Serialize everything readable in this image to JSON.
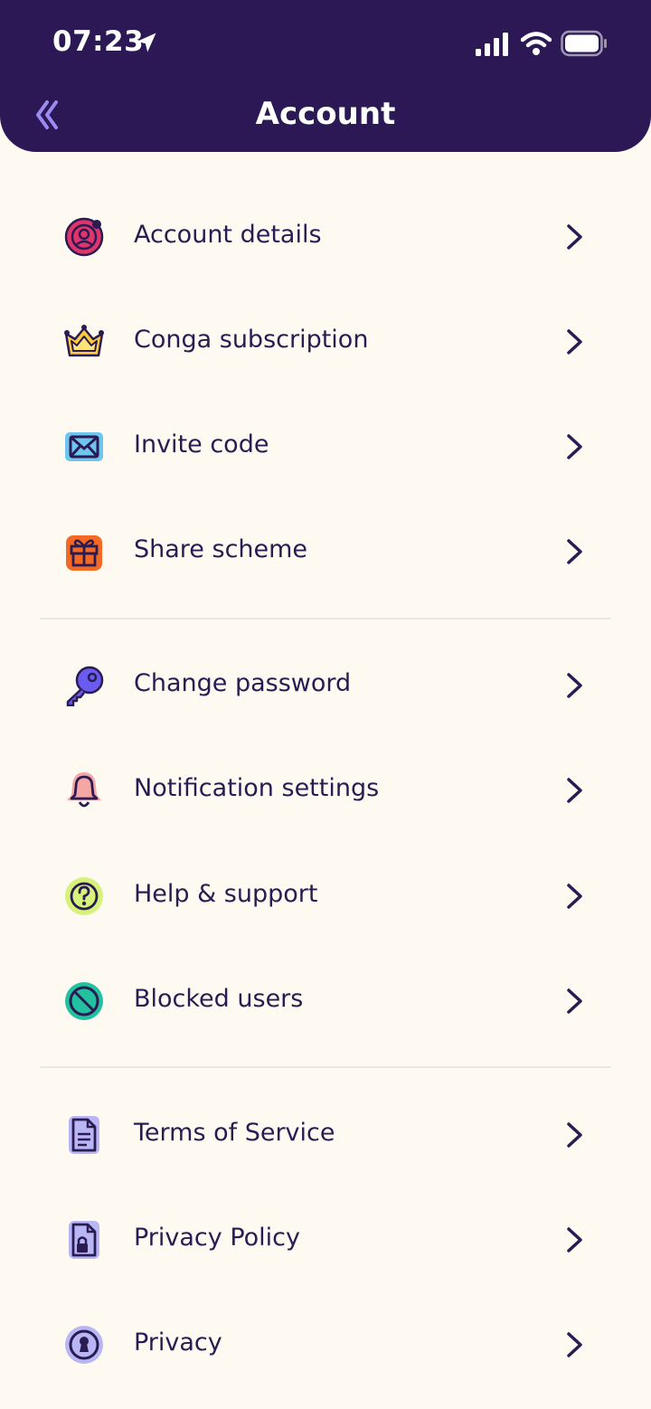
{
  "status_bar": {
    "time": "07:23"
  },
  "header": {
    "title": "Account"
  },
  "menu": {
    "group1": [
      {
        "label": "Account details",
        "icon": "account-circle-icon",
        "color": "#E0356B"
      },
      {
        "label": "Conga subscription",
        "icon": "crown-icon",
        "color": "#FFCB3D"
      },
      {
        "label": "Invite code",
        "icon": "envelope-icon",
        "color": "#6EC6F0"
      },
      {
        "label": "Share scheme",
        "icon": "gift-icon",
        "color": "#F46A24"
      }
    ],
    "group2": [
      {
        "label": "Change password",
        "icon": "key-icon",
        "color": "#6A5CF0"
      },
      {
        "label": "Notification settings",
        "icon": "bell-icon",
        "color": "#F7A6A6"
      },
      {
        "label": "Help & support",
        "icon": "question-circle-icon",
        "color": "#D7F27A"
      },
      {
        "label": "Blocked users",
        "icon": "block-icon",
        "color": "#22C2A0"
      }
    ],
    "group3": [
      {
        "label": "Terms of Service",
        "icon": "document-icon",
        "color": "#B9B6F5"
      },
      {
        "label": "Privacy Policy",
        "icon": "locked-file-icon",
        "color": "#B9B6F5"
      },
      {
        "label": "Privacy",
        "icon": "keyhole-icon",
        "color": "#B9B6F5"
      }
    ]
  }
}
